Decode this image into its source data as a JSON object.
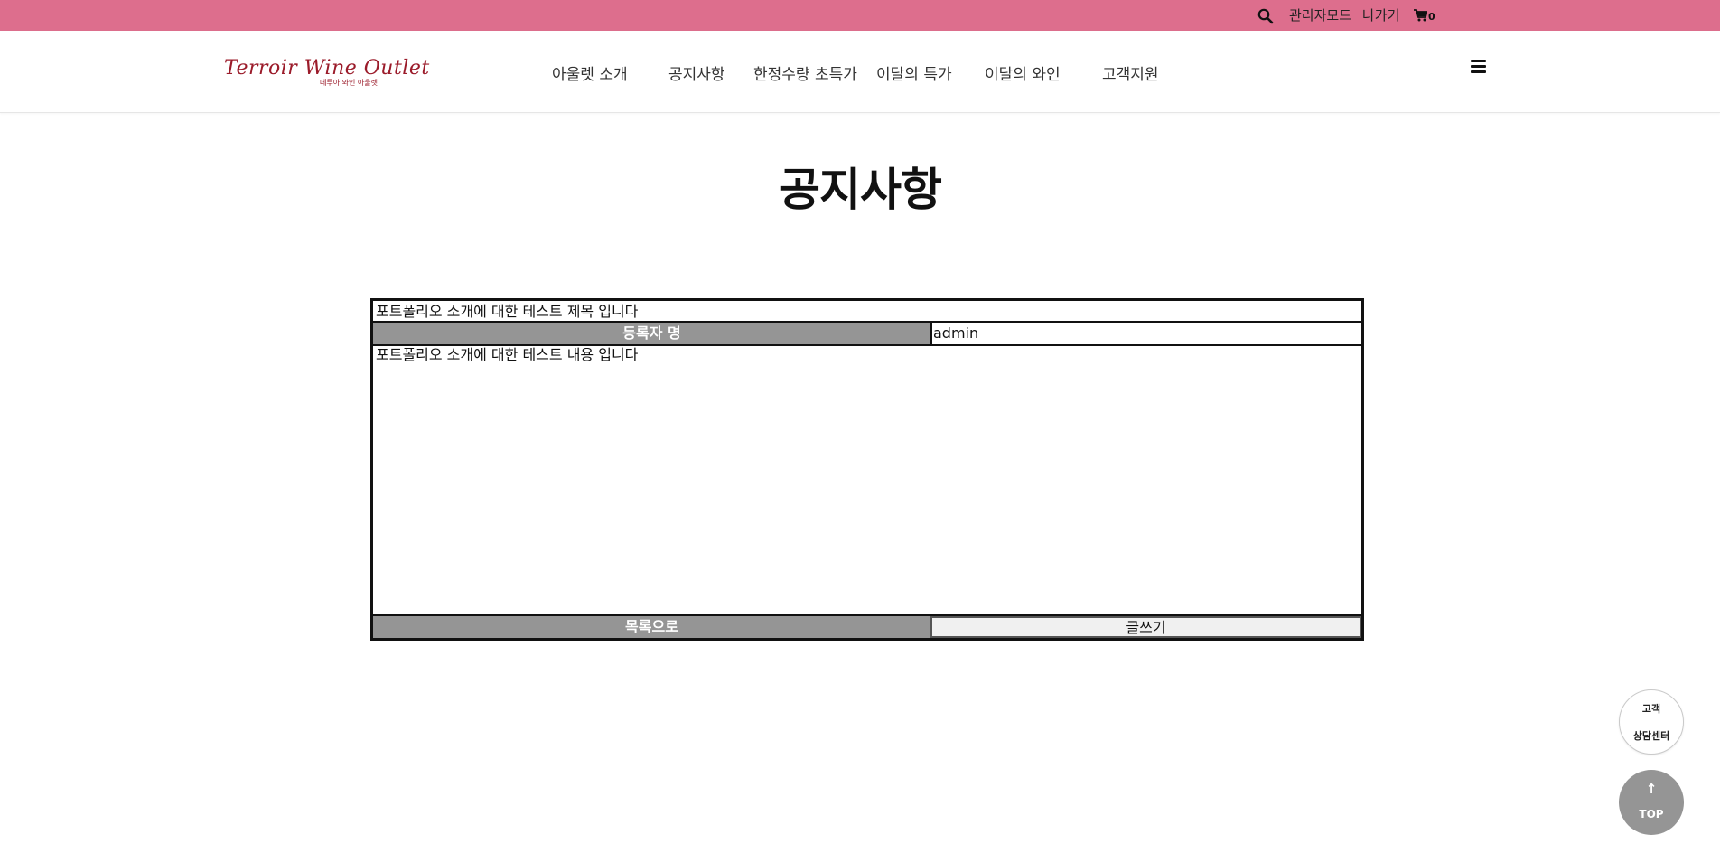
{
  "topbar": {
    "admin_label": "관리자모드",
    "logout_label": "나가기",
    "cart_count": "0",
    "search_icon": "search-icon",
    "cart_icon": "cart-icon"
  },
  "header": {
    "logo_text": "Terroir Wine Outlet",
    "logo_subtext": "떼루아 와인 아울렛",
    "nav": [
      {
        "label": "아울렛 소개"
      },
      {
        "label": "공지사항"
      },
      {
        "label": "한정수량 초특가"
      },
      {
        "label": "이달의 특가"
      },
      {
        "label": "이달의 와인"
      },
      {
        "label": "고객지원"
      }
    ],
    "menu_icon": "hamburger-icon"
  },
  "page": {
    "title": "공지사항"
  },
  "notice": {
    "subject": "포트폴리오 소개에 대한 테스트 제목 입니다",
    "writer_label": "등록자 명",
    "writer_value": "admin",
    "content": "포트폴리오 소개에 대한 테스트 내용 입니다",
    "list_button": "목록으로",
    "write_button": "글쓰기"
  },
  "floating": {
    "consult_line1": "고객",
    "consult_line2": "상담센터",
    "top_arrow": "↑",
    "top_label": "TOP"
  },
  "colors": {
    "topbar": "#dd6e8d",
    "button_gray": "#959595",
    "logo_red": "#9b1b2a"
  }
}
